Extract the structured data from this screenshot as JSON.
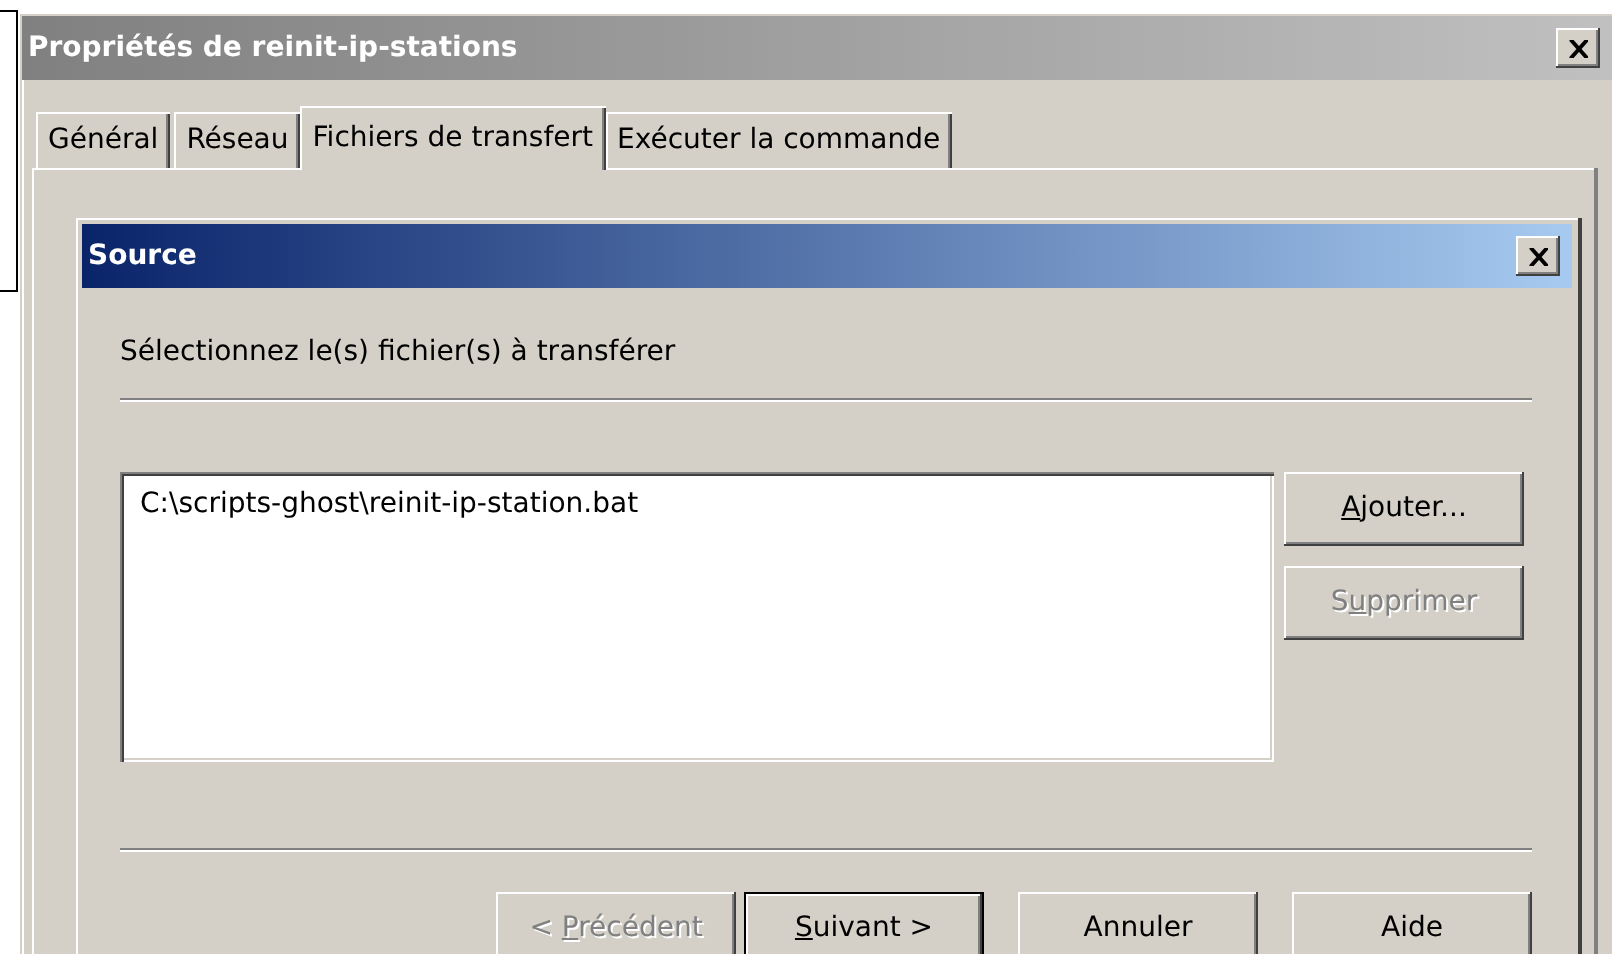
{
  "window": {
    "title": "Propriétés de reinit-ip-stations",
    "active": false
  },
  "tabs": [
    {
      "label": "Général",
      "selected": false
    },
    {
      "label": "Réseau",
      "selected": false
    },
    {
      "label": "Fichiers de transfert",
      "selected": true
    },
    {
      "label": "Exécuter la commande",
      "selected": false
    }
  ],
  "dialog": {
    "title": "Source",
    "active": true,
    "instruction": "Sélectionnez le(s) fichier(s) à transférer",
    "files": [
      "C:\\scripts-ghost\\reinit-ip-station.bat"
    ],
    "side_buttons": [
      {
        "label": [
          {
            "text": "A",
            "underlined": true
          },
          {
            "text": "jouter...",
            "underlined": false
          }
        ],
        "disabled": false
      },
      {
        "label": [
          {
            "text": "S",
            "underlined": false
          },
          {
            "text": "u",
            "underlined": true
          },
          {
            "text": "pprimer",
            "underlined": false
          }
        ],
        "disabled": true
      }
    ],
    "footer_buttons": [
      {
        "label": [
          {
            "text": "< ",
            "underlined": false
          },
          {
            "text": "P",
            "underlined": true
          },
          {
            "text": "récédent",
            "underlined": false
          }
        ],
        "disabled": true,
        "default": false
      },
      {
        "label": [
          {
            "text": "S",
            "underlined": true
          },
          {
            "text": "uivant >",
            "underlined": false
          }
        ],
        "disabled": false,
        "default": true
      },
      {
        "label": [
          {
            "text": "Annuler",
            "underlined": false
          }
        ],
        "disabled": false,
        "default": false
      },
      {
        "label": [
          {
            "text": "Aide",
            "underlined": false
          }
        ],
        "disabled": false,
        "default": false
      }
    ]
  }
}
